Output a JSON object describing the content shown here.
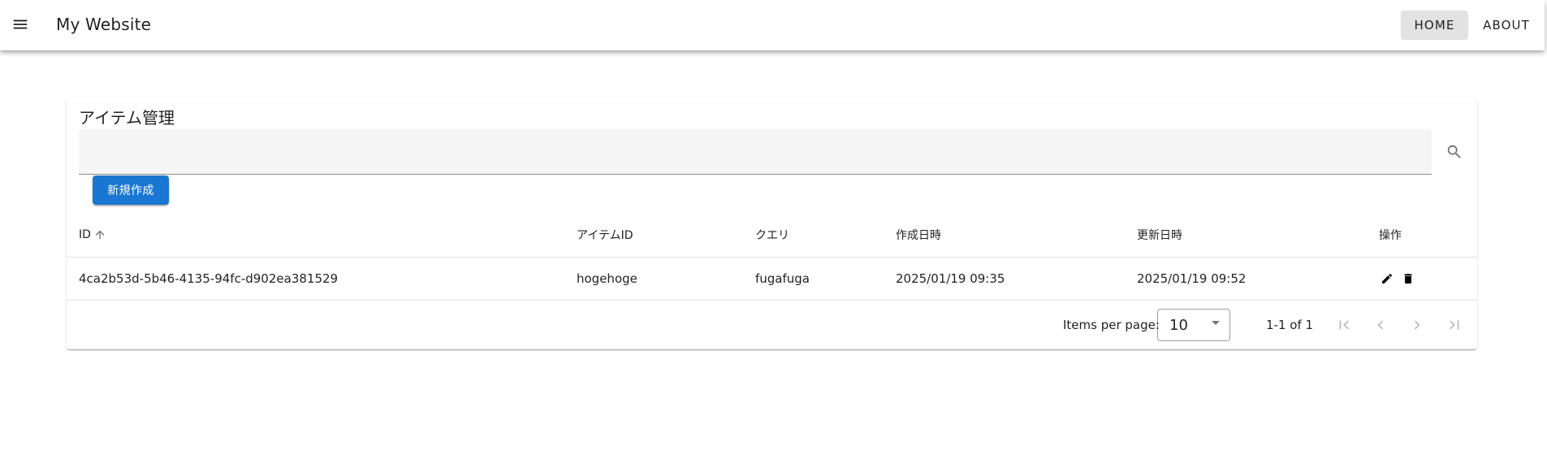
{
  "app": {
    "title": "My Website",
    "nav": [
      {
        "label": "HOME",
        "active": true
      },
      {
        "label": "ABOUT",
        "active": false
      }
    ]
  },
  "card": {
    "title": "アイテム管理",
    "search": {
      "value": "",
      "placeholder": ""
    },
    "create_label": "新規作成"
  },
  "table": {
    "headers": {
      "id": "ID",
      "item_id": "アイテムID",
      "query": "クエリ",
      "created_at": "作成日時",
      "updated_at": "更新日時",
      "actions": "操作"
    },
    "sort": {
      "column": "id",
      "direction": "ascending"
    },
    "rows": [
      {
        "id": "4ca2b53d-5b46-4135-94fc-d902ea381529",
        "item_id": "hogehoge",
        "query": "fugafuga",
        "created_at": "2025/01/19 09:35",
        "updated_at": "2025/01/19 09:52"
      }
    ]
  },
  "pagination": {
    "items_per_page_label": "Items per page:",
    "items_per_page": "10",
    "range": "1-1 of 1"
  },
  "icons": {
    "menu": "menu-icon",
    "search": "search-icon",
    "sort": "arrow-up-icon",
    "edit": "pencil-icon",
    "delete": "trash-icon",
    "first": "first-page-icon",
    "prev": "chevron-left-icon",
    "next": "chevron-right-icon",
    "last": "last-page-icon"
  },
  "colors": {
    "primary": "#1976d2",
    "active_nav_bg": "#e2e2e2",
    "field_bg": "#f5f5f5"
  }
}
